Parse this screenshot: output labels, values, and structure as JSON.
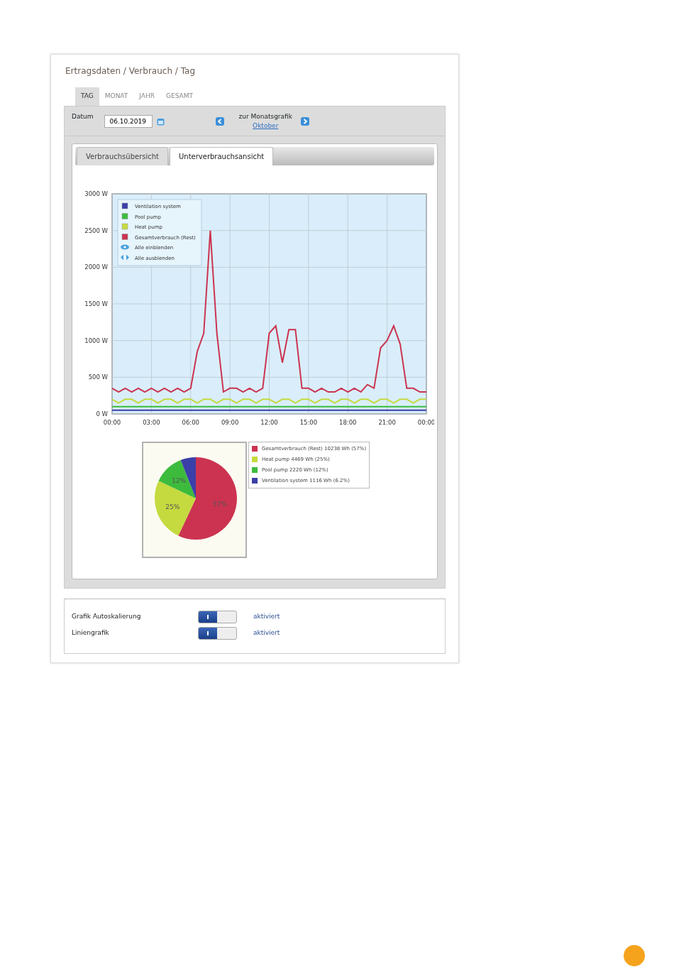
{
  "breadcrumb": "Ertragsdaten / Verbrauch / Tag",
  "period_tabs": [
    {
      "label": "TAG",
      "selected": true
    },
    {
      "label": "MONAT",
      "selected": false
    },
    {
      "label": "JAHR",
      "selected": false
    },
    {
      "label": "GESAMT",
      "selected": false
    }
  ],
  "date_bar": {
    "label": "Datum",
    "value": "06.10.2019",
    "nav_title": "zur Monatsgrafik",
    "nav_link": "Oktober"
  },
  "view_tabs": [
    {
      "label": "Verbrauchsübersicht",
      "selected": false
    },
    {
      "label": "Unterverbrauchsansicht",
      "selected": true
    }
  ],
  "line_chart": {
    "legend_actions": [
      {
        "kind": "show",
        "label": "Alle einblenden"
      },
      {
        "kind": "hide",
        "label": "Alle ausblenden"
      }
    ],
    "chart_data": {
      "type": "line",
      "grid": true,
      "legend": true,
      "x": [
        0,
        0.5,
        1,
        1.5,
        2,
        2.5,
        3,
        3.5,
        4,
        4.5,
        5,
        5.5,
        6,
        6.5,
        7,
        7.5,
        8,
        8.5,
        9,
        9.5,
        10,
        10.5,
        11,
        11.5,
        12,
        12.5,
        13,
        13.5,
        14,
        14.5,
        15,
        15.5,
        16,
        16.5,
        17,
        17.5,
        18,
        18.5,
        19,
        19.5,
        20,
        20.5,
        21,
        21.5,
        22,
        22.5,
        23,
        23.5,
        24
      ],
      "xlim": [
        0,
        24
      ],
      "ylim": [
        0,
        3000
      ],
      "yticks": [
        {
          "value": 0,
          "label": "0 W"
        },
        {
          "value": 500,
          "label": "500 W"
        },
        {
          "value": 1000,
          "label": "1000 W"
        },
        {
          "value": 1500,
          "label": "1500 W"
        },
        {
          "value": 2000,
          "label": "2000 W"
        },
        {
          "value": 2500,
          "label": "2500 W"
        },
        {
          "value": 3000,
          "label": "3000 W"
        }
      ],
      "xticks": [
        {
          "value": 0,
          "label": "00:00"
        },
        {
          "value": 3,
          "label": "03:00"
        },
        {
          "value": 6,
          "label": "06:00"
        },
        {
          "value": 9,
          "label": "09:00"
        },
        {
          "value": 12,
          "label": "12:00"
        },
        {
          "value": 15,
          "label": "15:00"
        },
        {
          "value": 18,
          "label": "18:00"
        },
        {
          "value": 21,
          "label": "21:00"
        },
        {
          "value": 24,
          "label": "00:00"
        }
      ],
      "series": [
        {
          "name": "Ventilation system",
          "color": "#3b3fa8",
          "values": [
            50,
            50,
            50,
            50,
            50,
            50,
            50,
            50,
            50,
            50,
            50,
            50,
            50,
            50,
            50,
            50,
            50,
            50,
            50,
            50,
            50,
            50,
            50,
            50,
            50,
            50,
            50,
            50,
            50,
            50,
            50,
            50,
            50,
            50,
            50,
            50,
            50,
            50,
            50,
            50,
            50,
            50,
            50,
            50,
            50,
            50,
            50,
            50,
            50
          ]
        },
        {
          "name": "Pool pump",
          "color": "#3dbb3d",
          "values": [
            100,
            100,
            100,
            100,
            100,
            100,
            100,
            100,
            100,
            100,
            100,
            100,
            100,
            100,
            100,
            100,
            100,
            100,
            100,
            100,
            100,
            100,
            100,
            100,
            100,
            100,
            100,
            100,
            100,
            100,
            100,
            100,
            100,
            100,
            100,
            100,
            100,
            100,
            100,
            100,
            100,
            100,
            100,
            100,
            100,
            100,
            100,
            100,
            100
          ]
        },
        {
          "name": "Heat pump",
          "color": "#c5da3f",
          "values": [
            200,
            150,
            200,
            200,
            150,
            200,
            200,
            150,
            200,
            200,
            150,
            200,
            200,
            150,
            200,
            200,
            150,
            200,
            200,
            150,
            200,
            200,
            150,
            200,
            200,
            150,
            200,
            200,
            150,
            200,
            200,
            150,
            200,
            200,
            150,
            200,
            200,
            150,
            200,
            200,
            150,
            200,
            200,
            150,
            200,
            200,
            150,
            200,
            200
          ]
        },
        {
          "name": "Gesamtverbrauch (Rest)",
          "color": "#cc3350",
          "values": [
            350,
            300,
            350,
            300,
            350,
            300,
            350,
            300,
            350,
            300,
            350,
            300,
            350,
            850,
            1100,
            2500,
            1100,
            300,
            350,
            350,
            300,
            350,
            300,
            350,
            1100,
            1200,
            700,
            1150,
            1150,
            350,
            350,
            300,
            350,
            300,
            300,
            350,
            300,
            350,
            300,
            400,
            350,
            900,
            1000,
            1200,
            950,
            350,
            350,
            300,
            300
          ]
        }
      ]
    }
  },
  "pie": {
    "slice_labels": [
      {
        "text": "57%"
      },
      {
        "text": "25%"
      },
      {
        "text": "12%"
      }
    ],
    "legend": [
      {
        "color": "#cc3350"
      },
      {
        "color": "#c5da3f"
      },
      {
        "color": "#3dbb3d"
      },
      {
        "color": "#3b3fa8"
      }
    ],
    "chart_data": {
      "type": "pie",
      "legend": true,
      "categories": [
        "Gesamtverbrauch (Rest) 10238 Wh (57%)",
        "Heat pump 4469 Wh (25%)",
        "Pool pump 2220 Wh (12%)",
        "Ventilation system 1116 Wh (6.2%)"
      ],
      "values": [
        57,
        25,
        12,
        6
      ]
    }
  },
  "settings": [
    {
      "label": "Grafik Autoskalierung",
      "on": true,
      "status": "aktiviert"
    },
    {
      "label": "Liniengrafik",
      "on": true,
      "status": "aktiviert"
    }
  ]
}
